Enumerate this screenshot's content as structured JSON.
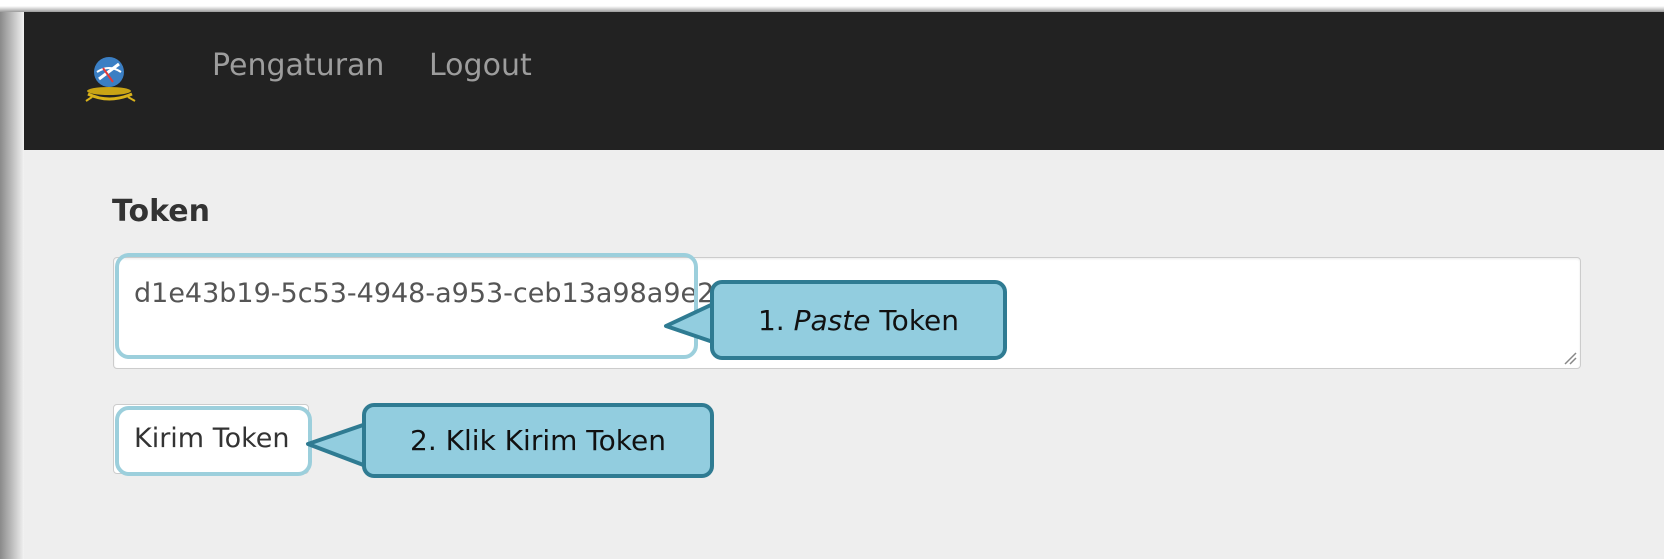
{
  "navbar": {
    "logo_icon": "globe-emblem-icon",
    "links": [
      "Pengaturan",
      "Logout"
    ]
  },
  "form": {
    "label": "Token",
    "token_value": "d1e43b19-5c53-4948-a953-ceb13a98a9e2",
    "submit_label": "Kirim Token"
  },
  "callouts": {
    "step1_prefix": "1. ",
    "step1_emph": "Paste",
    "step1_suffix": " Token",
    "step2": "2. Klik Kirim Token"
  },
  "colors": {
    "navbar_bg": "#222222",
    "nav_text": "#9d9d9d",
    "page_bg": "#eeeeee",
    "callout_fill": "#92cddf",
    "callout_border": "#2f7b92",
    "highlight_border": "#9ccfdc"
  }
}
